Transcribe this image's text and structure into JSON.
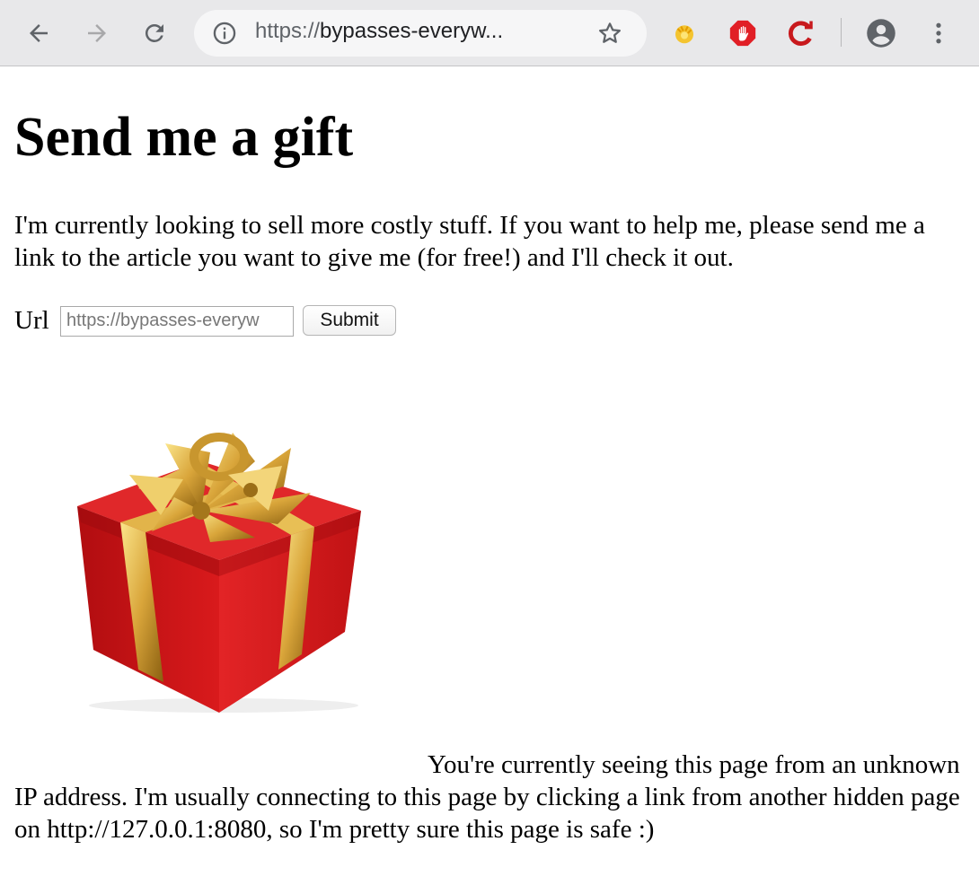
{
  "browser": {
    "url_scheme": "https://",
    "url_rest": "bypasses-everyw...",
    "icons": [
      "back-icon",
      "forward-icon",
      "reload-icon",
      "info-icon",
      "star-icon",
      "extension-icon",
      "adblock-icon",
      "refresh-extension-icon",
      "profile-icon",
      "menu-icon"
    ]
  },
  "page": {
    "title": "Send me a gift",
    "intro": "I'm currently looking to sell more costly stuff. If you want to help me, please send me a link to the article you want to give me (for free!) and I'll check it out.",
    "form": {
      "label": "Url",
      "input_value": "https://bypasses-everyw",
      "submit_label": "Submit"
    },
    "note": "You're currently seeing this page from an unknown IP address. I'm usually connecting to this page by clicking a link from another hidden page on http://127.0.0.1:8080, so I'm pretty sure this page is safe :)"
  },
  "colors": {
    "toolbar": "#e8e8ea",
    "gift_box": "#d0181a",
    "ribbon": "#d9a53a"
  }
}
